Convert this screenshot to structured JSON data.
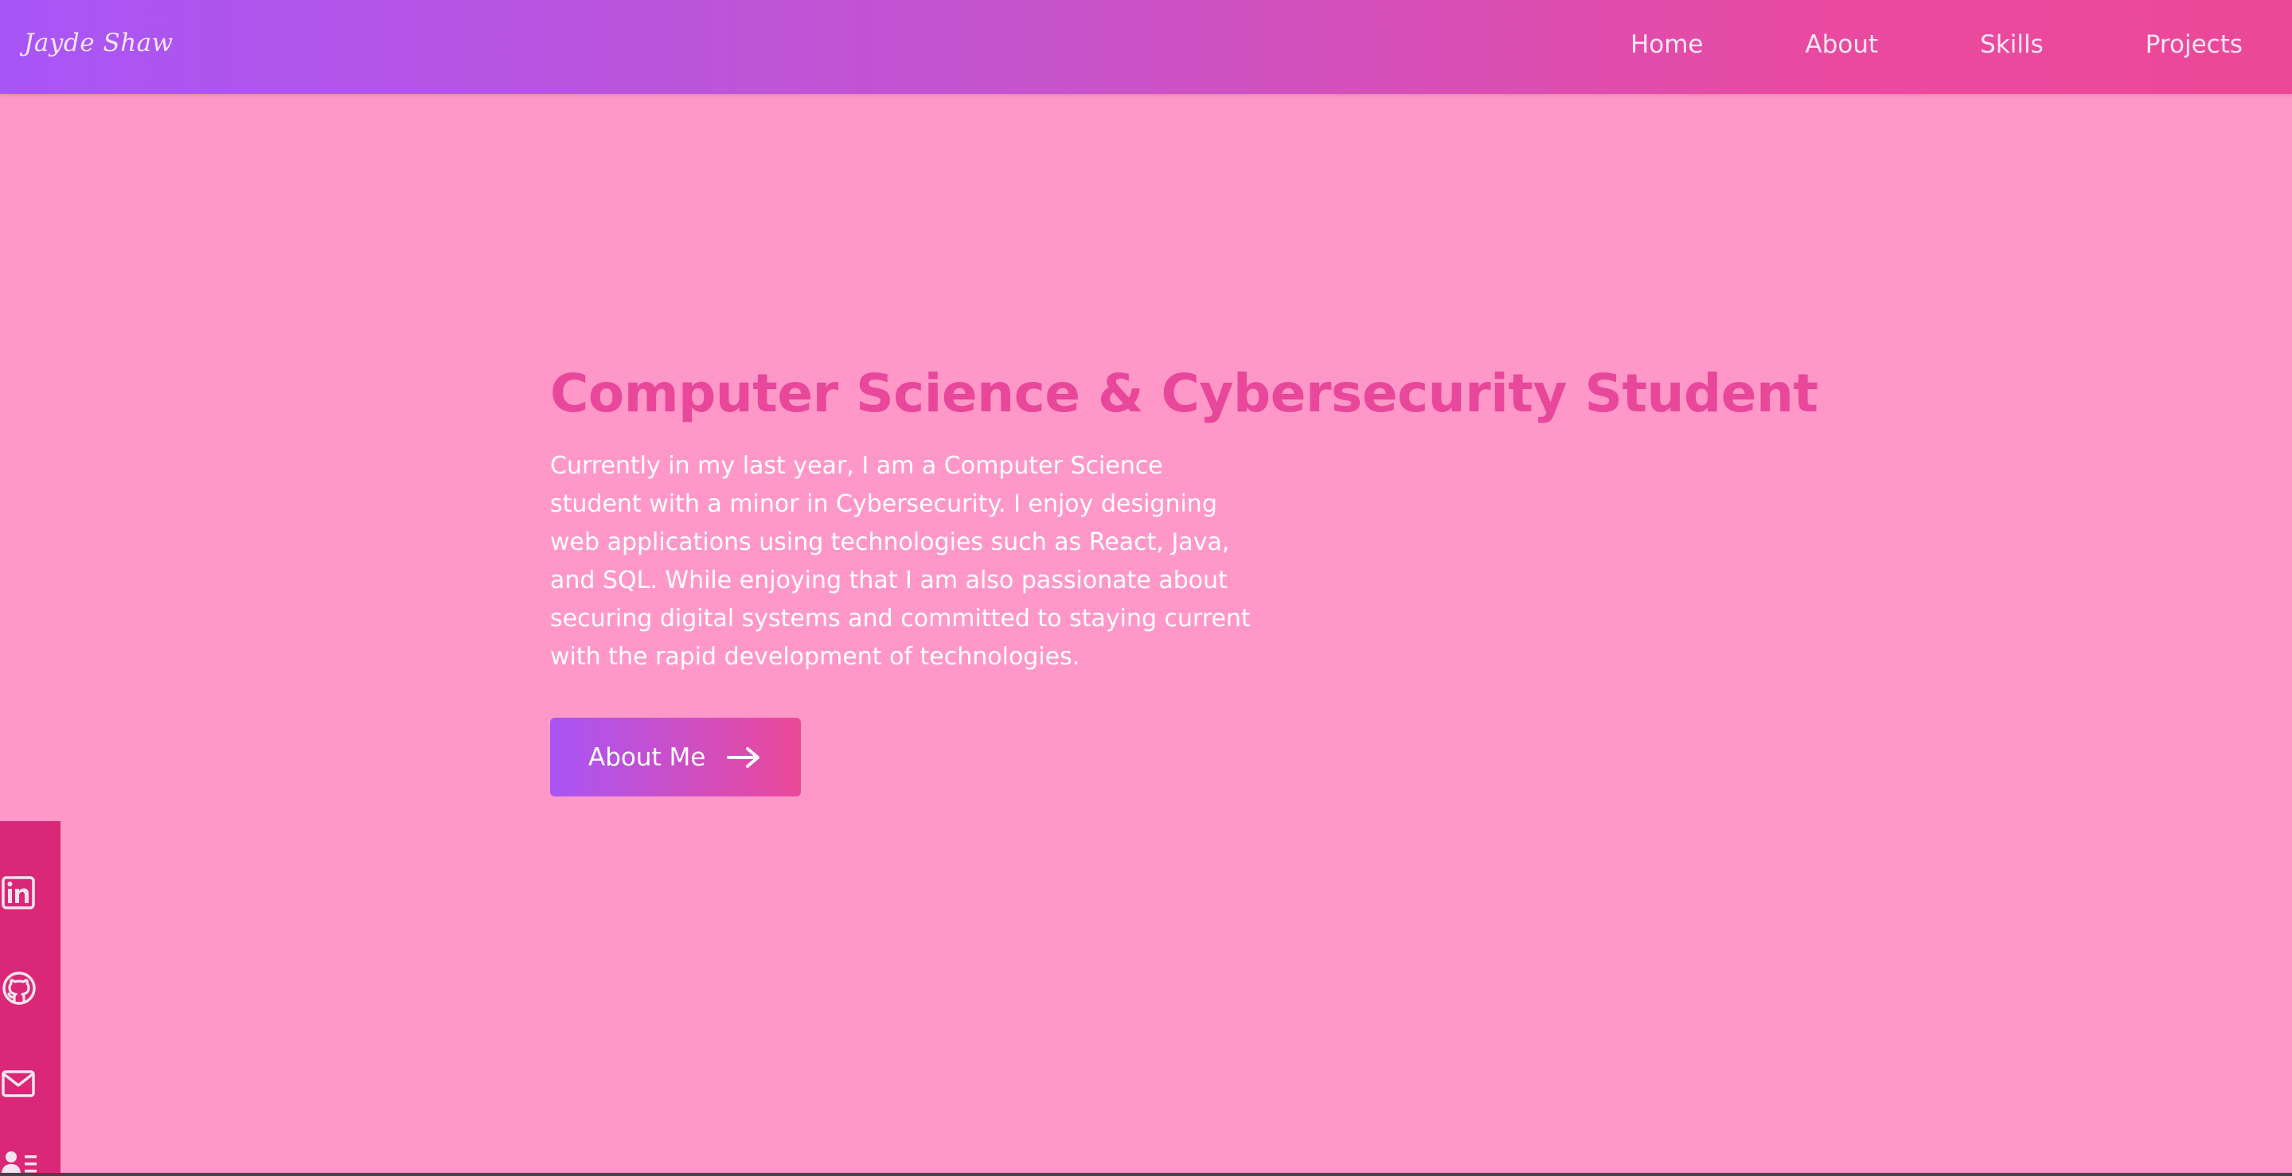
{
  "header": {
    "brand": "Jayde Shaw",
    "nav": [
      {
        "label": "Home"
      },
      {
        "label": "About"
      },
      {
        "label": "Skills"
      },
      {
        "label": "Projects"
      }
    ]
  },
  "hero": {
    "title": "Computer Science & Cybersecurity Student",
    "description": "Currently in my last year, I am a Computer Science student with a minor in Cybersecurity. I enjoy designing web applications using technologies such as React, Java, and SQL. While enjoying that I am also passionate about securing digital systems and committed to staying current with the rapid development of technologies.",
    "button_label": "About Me",
    "button_icon": "arrow-right-icon"
  },
  "social": {
    "items": [
      {
        "icon": "linkedin-icon"
      },
      {
        "icon": "github-icon"
      },
      {
        "icon": "mail-icon"
      },
      {
        "icon": "resume-icon"
      }
    ]
  },
  "colors": {
    "background": "#ff98c8",
    "accent_pink": "#ec4899",
    "accent_purple": "#a855f7",
    "sidebar": "#db2777",
    "title": "#e8479a"
  }
}
